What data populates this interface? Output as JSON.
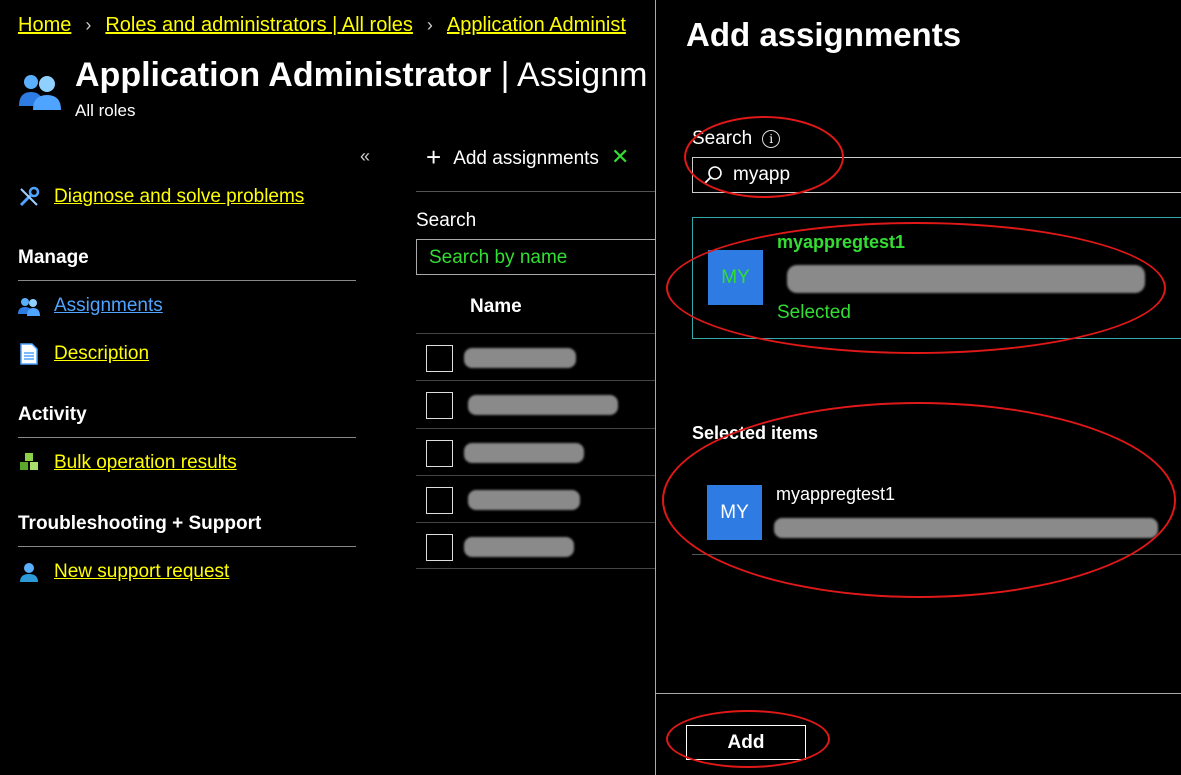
{
  "breadcrumb": {
    "home": "Home",
    "roles": "Roles and administrators | All roles",
    "current": "Application Administ"
  },
  "header": {
    "title_bold": "Application Administrator",
    "title_rest": " | Assignm",
    "subtitle": "All roles"
  },
  "sidebar": {
    "collapse_glyph": "«",
    "diagnose": "Diagnose and solve problems",
    "manage_section": "Manage",
    "assignments": "Assignments",
    "description": "Description",
    "activity_section": "Activity",
    "bulk": "Bulk operation results",
    "support_section": "Troubleshooting + Support",
    "new_support": "New support request"
  },
  "main": {
    "add_assignments": "Add assignments",
    "search_label": "Search",
    "search_placeholder": "Search by name",
    "name_column": "Name"
  },
  "panel": {
    "title": "Add assignments",
    "search_label": "Search",
    "search_value": "myapp",
    "result": {
      "initials": "MY",
      "name": "myappregtest1",
      "status": "Selected"
    },
    "selected_heading": "Selected items",
    "selected_item": {
      "initials": "MY",
      "name": "myappregtest1"
    },
    "add_button": "Add"
  },
  "colors": {
    "link": "#ffff00",
    "accent_green": "#33dd33",
    "avatar_blue": "#2d7be3",
    "annotation_red": "#e01818"
  }
}
